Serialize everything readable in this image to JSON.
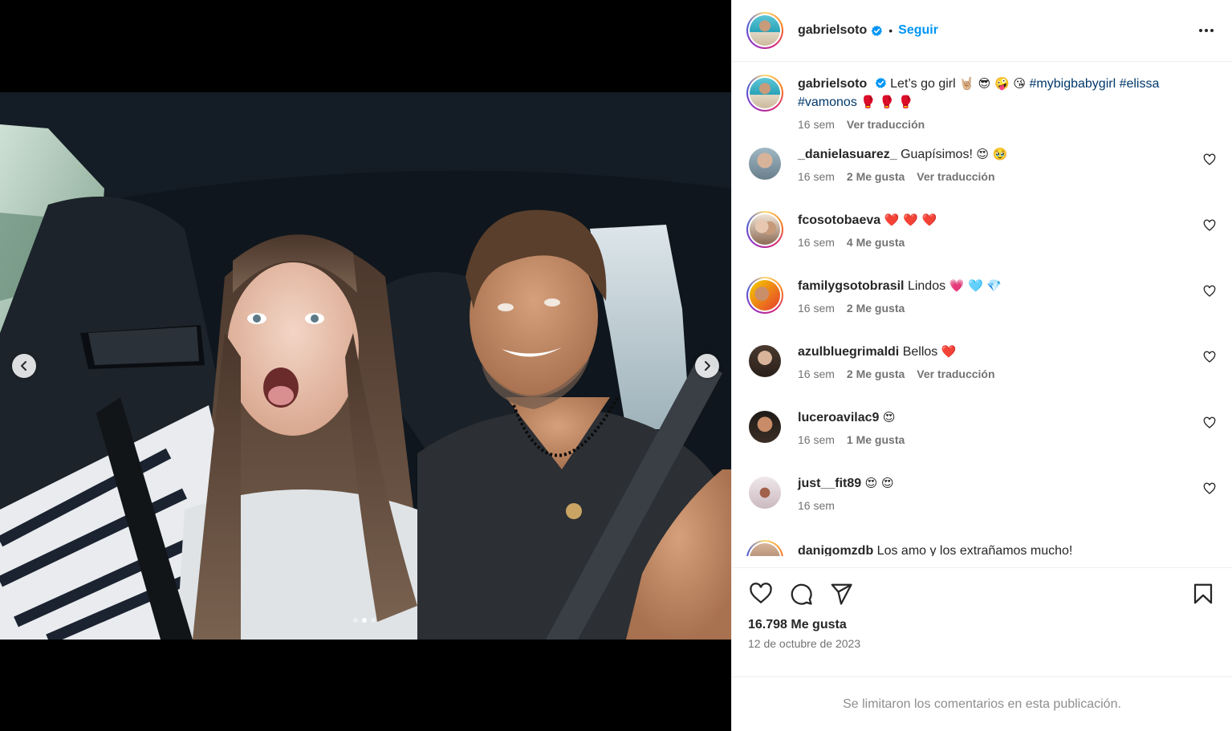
{
  "post": {
    "author": "gabrielsoto",
    "follow_label": "Seguir",
    "separator": "•",
    "caption": {
      "text": "Let’s go girl",
      "emojis_1": "🤘🏼 😎 🤪 😘",
      "hashtags": [
        "#mybigbabygirl",
        "#elissa",
        "#vamonos"
      ],
      "emojis_2": "🥊 🥊 🥊",
      "time": "16 sem",
      "translate": "Ver traducción"
    },
    "likes": "16.798 Me gusta",
    "date": "12 de octubre de 2023",
    "comments_limited": "Se limitaron los comentarios en esta publicación.",
    "carousel": {
      "count": 3,
      "active_index": 1
    }
  },
  "comments": [
    {
      "user": "_danielasuarez_",
      "text": "Guapísimos!",
      "emoji": "😍 🥹",
      "time": "16 sem",
      "likes": "2 Me gusta",
      "translate": "Ver traducción",
      "ring": false
    },
    {
      "user": "fcosotobaeva",
      "text": "",
      "emoji": "❤️ ❤️ ❤️",
      "time": "16 sem",
      "likes": "4 Me gusta",
      "translate": "",
      "ring": true
    },
    {
      "user": "familygsotobrasil",
      "text": "Lindos",
      "emoji": "💗 🩵 💎",
      "time": "16 sem",
      "likes": "2 Me gusta",
      "translate": "",
      "ring": true
    },
    {
      "user": "azulbluegrimaldi",
      "text": "Bellos",
      "emoji": "❤️",
      "time": "16 sem",
      "likes": "2 Me gusta",
      "translate": "Ver traducción",
      "ring": false
    },
    {
      "user": "luceroavilac9",
      "text": "",
      "emoji": "😍",
      "time": "16 sem",
      "likes": "1 Me gusta",
      "translate": "",
      "ring": false
    },
    {
      "user": "just__fit89",
      "text": "",
      "emoji": "😍 😍",
      "time": "16 sem",
      "likes": "",
      "translate": "",
      "ring": false
    }
  ],
  "partial_comment": {
    "user": "danigomzdb",
    "text": "Los amo y los extrañamos mucho!"
  },
  "colors": {
    "accent": "#0095f6",
    "hashtag": "#00376b",
    "meta": "#737373",
    "verified": "#0095f6"
  },
  "icons": [
    "chevron-left-icon",
    "chevron-right-icon",
    "more-icon",
    "verified-icon",
    "heart-icon",
    "comment-icon",
    "share-icon",
    "bookmark-icon"
  ]
}
